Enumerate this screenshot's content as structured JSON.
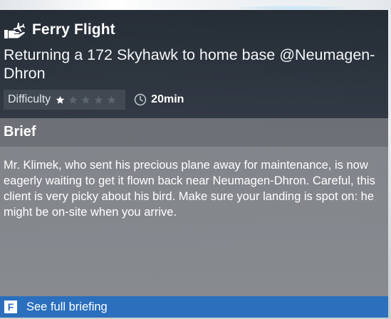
{
  "mission": {
    "type_label": "Ferry Flight",
    "description": "Returning a 172 Skyhawk to home base @Neumagen-Dhron",
    "difficulty_label": "Difficulty",
    "difficulty_level": 1,
    "difficulty_max": 5,
    "duration": "20min",
    "icon": "hand-plane-icon"
  },
  "brief": {
    "heading": "Brief",
    "text": "Mr. Klimek, who sent his precious plane away for maintenance, is now eagerly waiting to get it flown back near Neumagen-Dhron. Careful, this client is very picky about his bird. Make sure your landing is spot on: he might be on-site when you arrive."
  },
  "footer": {
    "key": "F",
    "label": "See full briefing"
  },
  "colors": {
    "accent": "#2b6fbd",
    "star_filled": "#ffffff",
    "star_empty": "#5c6470"
  }
}
